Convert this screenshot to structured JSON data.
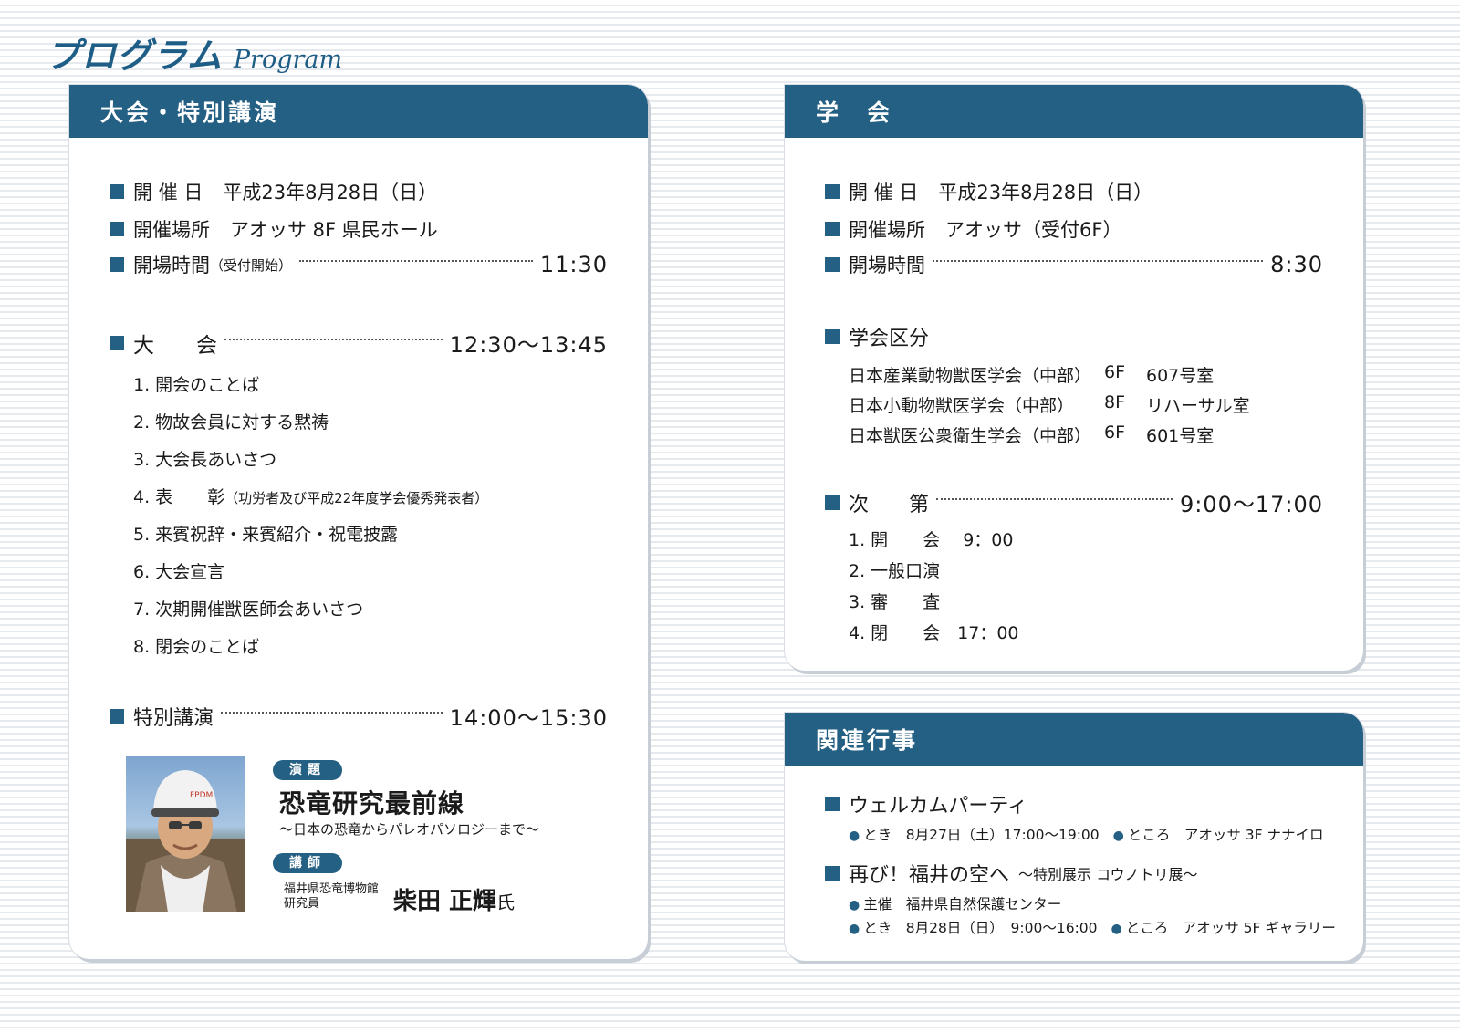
{
  "page_title": {
    "jp": "プログラム",
    "en": "Program"
  },
  "taikai": {
    "header": "大会・特別講演",
    "date_label": "開 催 日",
    "date_value": "平成23年8月28日（日）",
    "venue_label": "開催場所",
    "venue_value": "アオッサ 8F 県民ホール",
    "open_label": "開場時間",
    "open_note": "（受付開始）",
    "open_time": "11:30",
    "taikai_label": "大　　会",
    "taikai_time": "12:30～13:45",
    "items": [
      "1. 開会のことば",
      "2. 物故会員に対する黙祷",
      "3. 大会長あいさつ",
      "4. 表　　彰",
      "5. 来賓祝辞・来賓紹介・祝電披露",
      "6. 大会宣言",
      "7. 次期開催獣医師会あいさつ",
      "8. 閉会のことば"
    ],
    "award_note": "（功労者及び平成22年度学会優秀発表者）",
    "special_label": "特別講演",
    "special_time": "14:00～15:30",
    "topic_pill": "演題",
    "topic_title": "恐竜研究最前線",
    "topic_subtitle": "～日本の恐竜からパレオパソロジーまで～",
    "lecturer_pill": "講師",
    "lecturer_aff_1": "福井県恐竜博物館",
    "lecturer_aff_2": "研究員",
    "lecturer_name": "柴田 正輝",
    "lecturer_honorific": "氏",
    "photo_cap_text": "FPDM"
  },
  "gakkai": {
    "header": "学　会",
    "date_label": "開 催 日",
    "date_value": "平成23年8月28日（日）",
    "venue_label": "開催場所",
    "venue_value": "アオッサ（受付6F）",
    "open_label": "開場時間",
    "open_time": "8:30",
    "division_label": "学会区分",
    "divisions": [
      {
        "name": "日本産業動物獣医学会（中部）",
        "floor": "6F",
        "room": "607号室"
      },
      {
        "name": "日本小動物獣医学会（中部）",
        "floor": "8F",
        "room": "リハーサル室"
      },
      {
        "name": "日本獣医公衆衛生学会（中部）",
        "floor": "6F",
        "room": "601号室"
      }
    ],
    "order_label": "次　　第",
    "order_time": "9:00～17:00",
    "order_items": [
      "1. 開　　会　 9：00",
      "2. 一般口演",
      "3. 審　　査",
      "4. 閉　　会　17：00"
    ]
  },
  "kanren": {
    "header": "関連行事",
    "welcome_title": "ウェルカムパーティ",
    "welcome_when": "とき　8月27日（土）17:00～19:00",
    "welcome_where": "ところ　アオッサ 3F ナナイロ",
    "exhibit_title": "再び！福井の空へ",
    "exhibit_subtitle": "～特別展示 コウノトリ展～",
    "exhibit_host": "主催　福井県自然保護センター",
    "exhibit_when": "とき　8月28日（日）　9:00～16:00",
    "exhibit_where": "ところ　アオッサ 5F ギャラリー"
  }
}
